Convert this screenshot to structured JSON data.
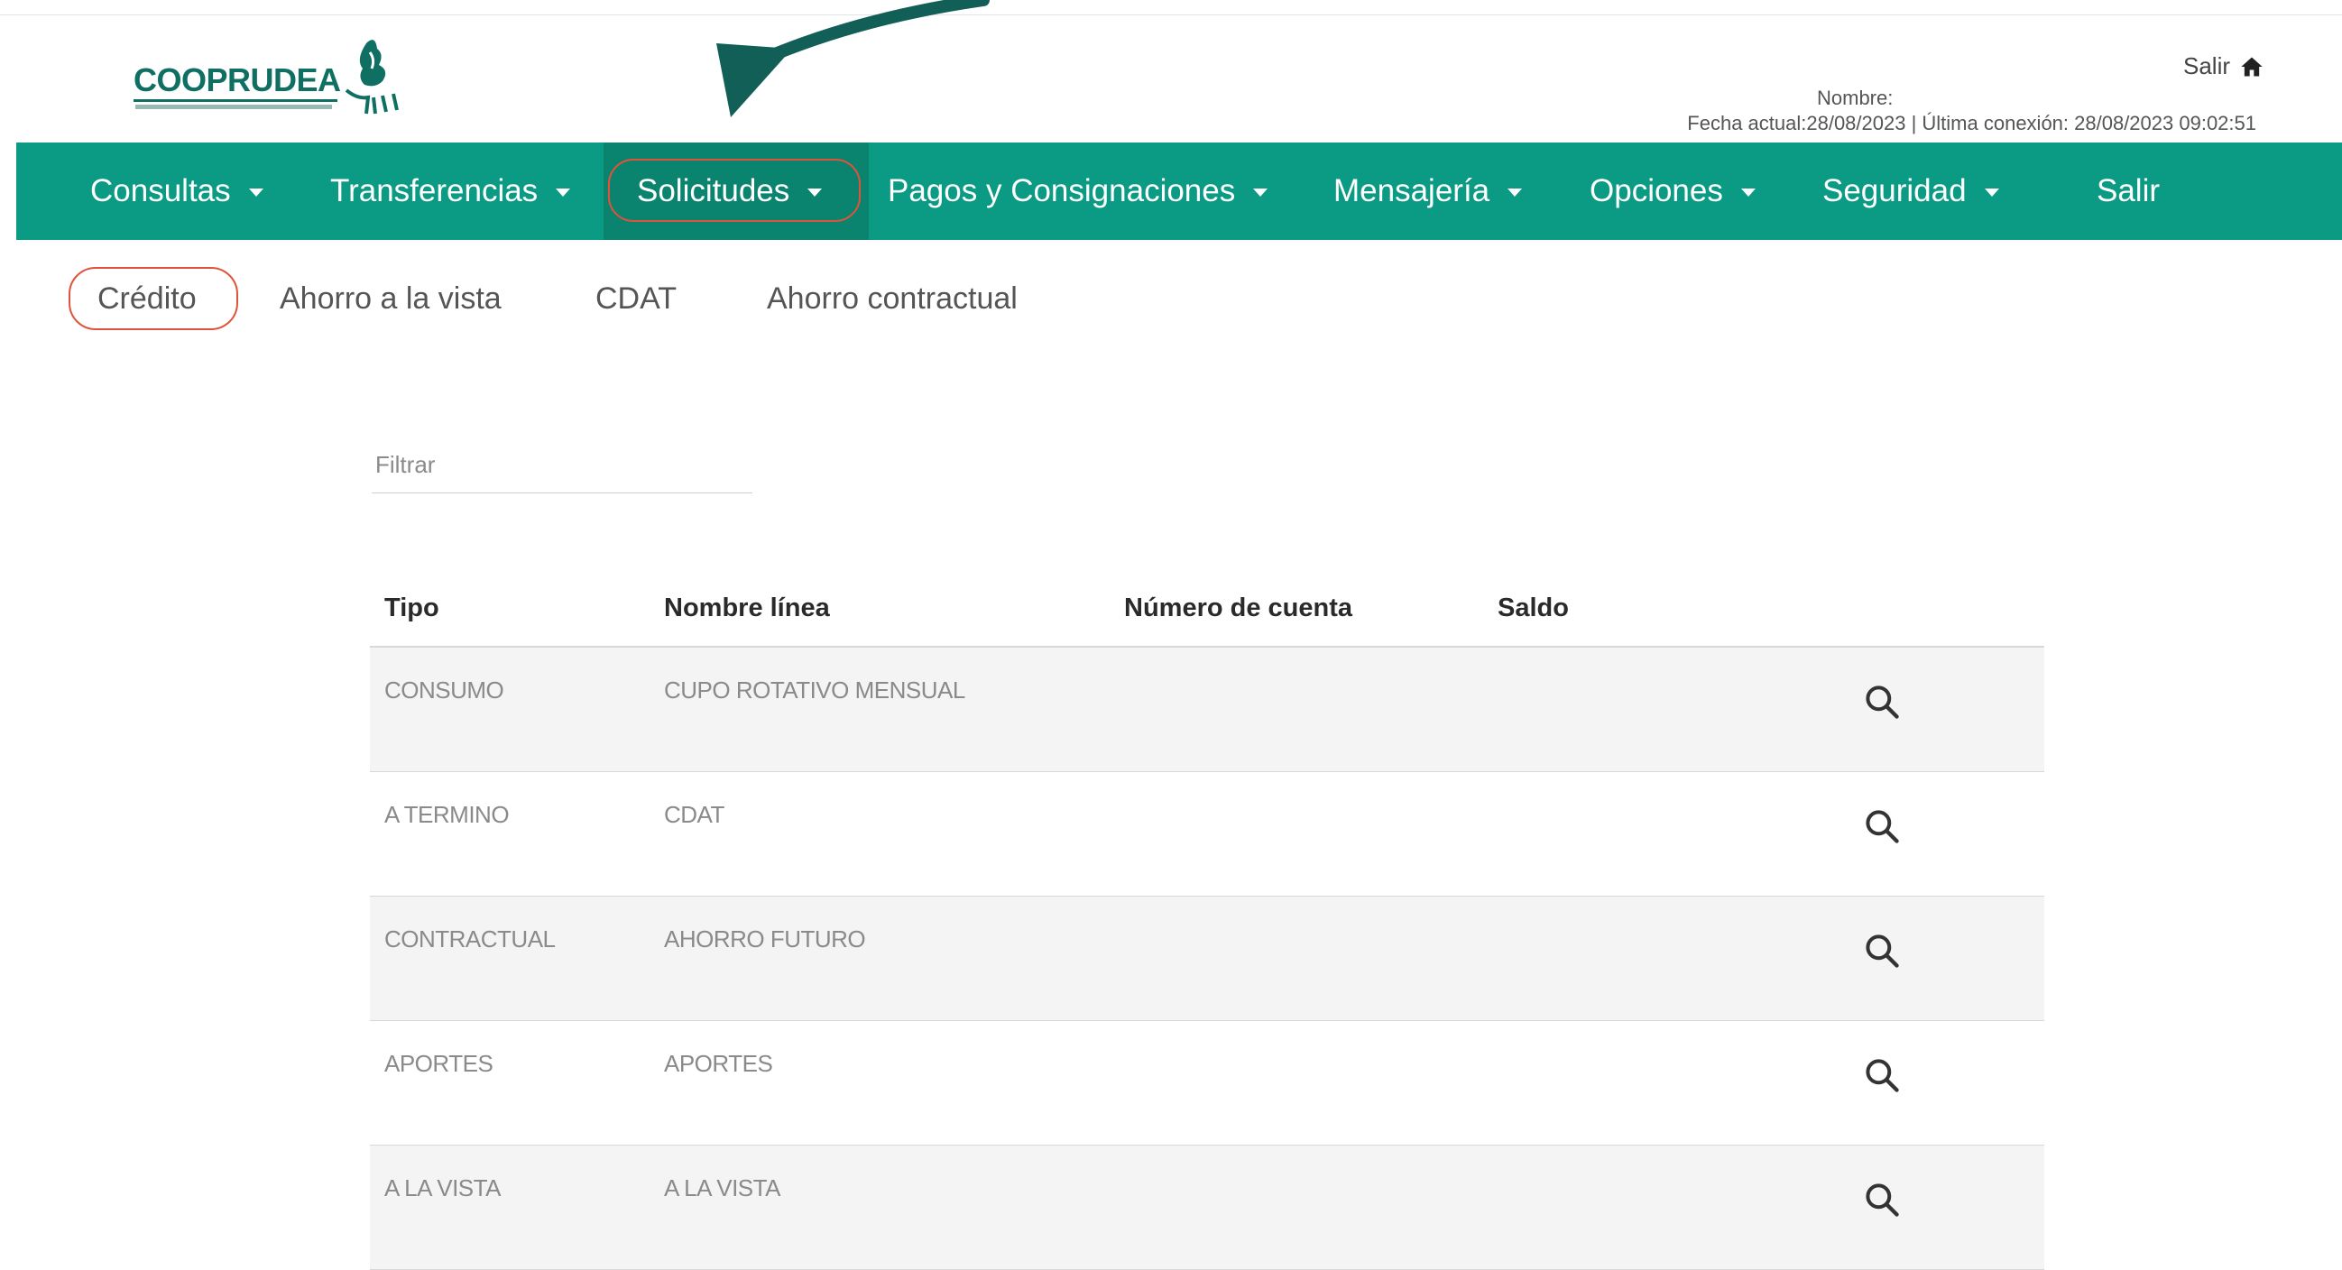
{
  "brand": {
    "logo_text": "COOPRUDEA"
  },
  "header": {
    "salir_label": "Salir",
    "nombre_label": "Nombre:",
    "fecha_text": "Fecha actual:28/08/2023 | Última conexión: 28/08/2023 09:02:51"
  },
  "nav": {
    "items": [
      {
        "label": "Consultas"
      },
      {
        "label": "Transferencias"
      },
      {
        "label": "Solicitudes"
      },
      {
        "label": "Pagos y Consignaciones"
      },
      {
        "label": "Mensajería"
      },
      {
        "label": "Opciones"
      },
      {
        "label": "Seguridad"
      },
      {
        "label": "Salir"
      }
    ],
    "active": "Solicitudes"
  },
  "subtabs": {
    "items": [
      {
        "label": "Crédito"
      },
      {
        "label": "Ahorro a la vista"
      },
      {
        "label": "CDAT"
      },
      {
        "label": "Ahorro contractual"
      }
    ],
    "active": "Crédito"
  },
  "filter": {
    "placeholder": "Filtrar",
    "value": ""
  },
  "table": {
    "headers": {
      "tipo": "Tipo",
      "nombre": "Nombre línea",
      "numero": "Número de cuenta",
      "saldo": "Saldo"
    },
    "rows": [
      {
        "tipo": "CONSUMO",
        "nombre": "CUPO ROTATIVO MENSUAL"
      },
      {
        "tipo": "A TERMINO",
        "nombre": "CDAT"
      },
      {
        "tipo": "CONTRACTUAL",
        "nombre": "AHORRO FUTURO"
      },
      {
        "tipo": "APORTES",
        "nombre": "APORTES"
      },
      {
        "tipo": "A LA VISTA",
        "nombre": "A LA VISTA"
      }
    ]
  },
  "colors": {
    "brand": "#0b9a83",
    "annotation": "#e0533a",
    "arrow": "#125f58"
  }
}
